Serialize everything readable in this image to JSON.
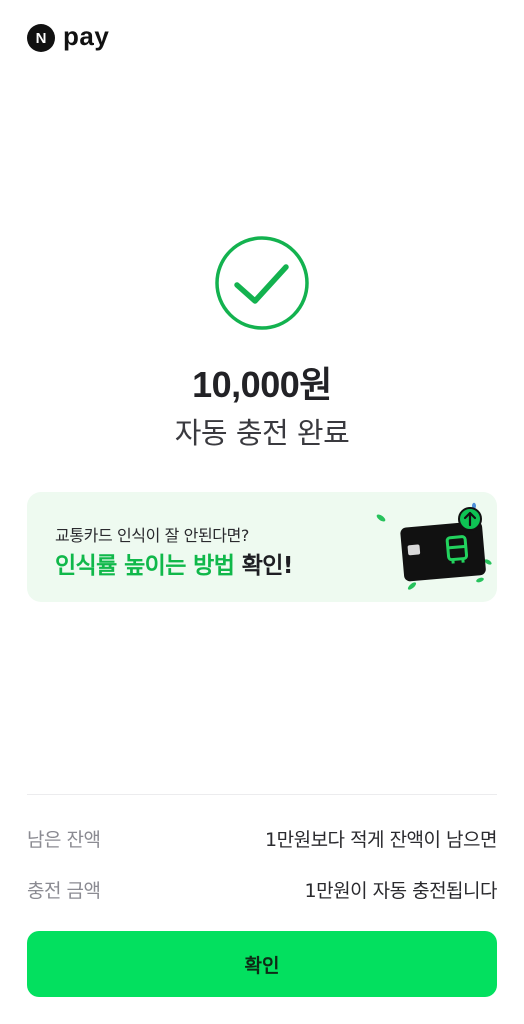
{
  "header": {
    "logo_letter": "N",
    "logo_text": "pay"
  },
  "result": {
    "icon": "check-circle-icon",
    "amount": "10,000원",
    "status": "자동 충전 완료"
  },
  "banner": {
    "subtitle": "교통카드 인식이 잘 안된다면?",
    "title_highlight": "인식률 높이는 방법",
    "title_rest": " 확인!",
    "icon": "transit-card-icon"
  },
  "info": {
    "rows": [
      {
        "label": "남은 잔액",
        "value": "1만원보다 적게 잔액이 남으면"
      },
      {
        "label": "충전 금액",
        "value": "1만원이 자동 충전됩니다"
      }
    ]
  },
  "footer": {
    "confirm_label": "확인"
  },
  "colors": {
    "accent": "#03e05f",
    "success": "#10b84a",
    "banner_bg": "#eefaf0"
  }
}
